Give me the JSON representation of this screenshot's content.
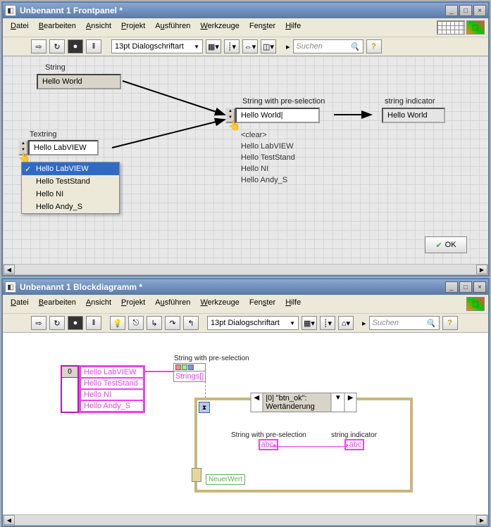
{
  "fp": {
    "title": "Unbenannt 1 Frontpanel *",
    "menus": [
      "Datei",
      "Bearbeiten",
      "Ansicht",
      "Projekt",
      "Ausführen",
      "Werkzeuge",
      "Fenster",
      "Hilfe"
    ],
    "font": "13pt Dialogschriftart",
    "search": "Suchen",
    "string": {
      "label": "String",
      "value": "Hello World"
    },
    "textring": {
      "label": "Textring",
      "value": "Hello LabVIEW",
      "items": [
        "Hello LabVIEW",
        "Hello TestStand",
        "Hello NI",
        "Hello Andy_S"
      ],
      "selected": 0
    },
    "preselect": {
      "label": "String with pre-selection",
      "value": "Hello World",
      "items": [
        "<clear>",
        "Hello LabVIEW",
        "Hello TestStand",
        "Hello NI",
        "Hello Andy_S"
      ]
    },
    "indicator": {
      "label": "string indicator",
      "value": "Hello World"
    },
    "ok": "OK"
  },
  "bd": {
    "title": "Unbenannt 1 Blockdiagramm *",
    "menus": [
      "Datei",
      "Bearbeiten",
      "Ansicht",
      "Projekt",
      "Ausführen",
      "Werkzeuge",
      "Fenster",
      "Hilfe"
    ],
    "font": "13pt Dialogschriftart",
    "search": "Suchen",
    "arr": {
      "idx": "0",
      "items": [
        "Hello LabVIEW",
        "Hello TestStand",
        "Hello NI",
        "Hello Andy_S"
      ]
    },
    "prop": "Strings[]",
    "event": {
      "idx": "0",
      "name": "\"btn_ok\": Wertänderung"
    },
    "psel": {
      "label": "String with pre-selection",
      "type": "abc"
    },
    "ind": {
      "label": "string indicator",
      "type": "abc"
    },
    "nw": "NeuerWert"
  }
}
